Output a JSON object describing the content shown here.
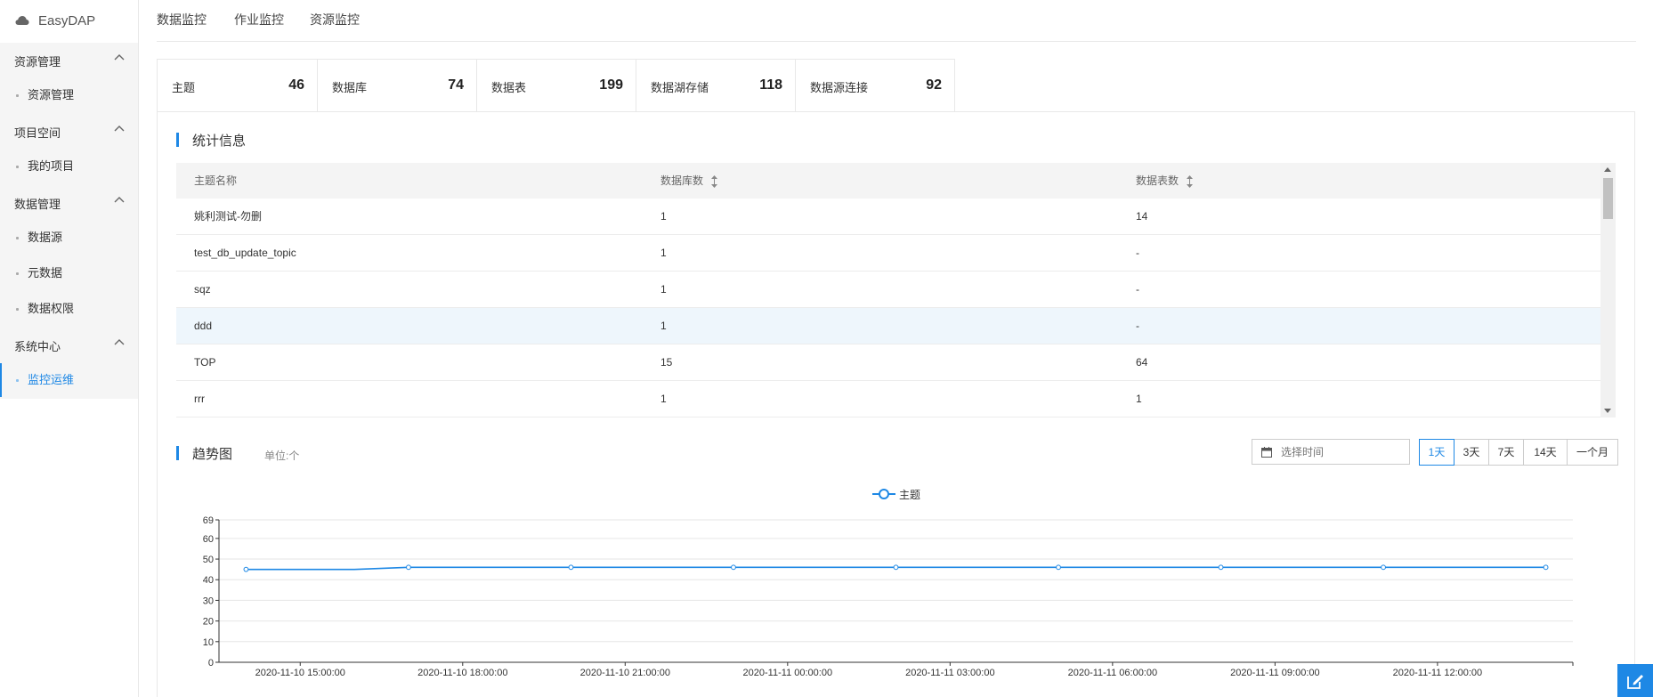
{
  "app": {
    "logo_text": "EasyDAP"
  },
  "sidebar": {
    "groups": [
      {
        "title": "资源管理",
        "items": [
          {
            "label": "资源管理",
            "active": false
          }
        ]
      },
      {
        "title": "项目空间",
        "items": [
          {
            "label": "我的项目",
            "active": false
          }
        ]
      },
      {
        "title": "数据管理",
        "items": [
          {
            "label": "数据源",
            "active": false
          },
          {
            "label": "元数据",
            "active": false
          },
          {
            "label": "数据权限",
            "active": false
          }
        ]
      },
      {
        "title": "系统中心",
        "items": [
          {
            "label": "监控运维",
            "active": true
          }
        ]
      }
    ]
  },
  "top_tabs": [
    {
      "label": "数据监控",
      "active": true
    },
    {
      "label": "作业监控",
      "active": false
    },
    {
      "label": "资源监控",
      "active": false
    }
  ],
  "stat_tabs": [
    {
      "label": "主题",
      "value": "46",
      "active": true
    },
    {
      "label": "数据库",
      "value": "74",
      "active": false
    },
    {
      "label": "数据表",
      "value": "199",
      "active": false
    },
    {
      "label": "数据湖存储",
      "value": "118",
      "active": false
    },
    {
      "label": "数据源连接",
      "value": "92",
      "active": false
    }
  ],
  "stats_section": {
    "title": "统计信息",
    "columns": [
      "主题名称",
      "数据库数",
      "数据表数"
    ],
    "rows": [
      [
        "姚利测试-勿删",
        "1",
        "14"
      ],
      [
        "test_db_update_topic",
        "1",
        "-"
      ],
      [
        "sqz",
        "1",
        "-"
      ],
      [
        "ddd",
        "1",
        "-"
      ],
      [
        "TOP",
        "15",
        "64"
      ],
      [
        "rrr",
        "1",
        "1"
      ]
    ],
    "highlighted_row": 3
  },
  "trend_section": {
    "title": "趋势图",
    "unit": "单位:个",
    "date_placeholder": "选择时间",
    "ranges": [
      {
        "label": "1天",
        "active": true
      },
      {
        "label": "3天",
        "active": false
      },
      {
        "label": "7天",
        "active": false
      },
      {
        "label": "14天",
        "active": false
      },
      {
        "label": "一个月",
        "active": false
      }
    ]
  },
  "colors": {
    "accent": "#1e88e5",
    "line": "#1e88e5"
  },
  "icons": {
    "logo": "cloud-icon",
    "collapse": "chevron-up-icon",
    "date": "calendar-icon",
    "sort": "sort-icon",
    "fab": "edit-icon"
  },
  "chart_data": {
    "type": "line",
    "series": [
      {
        "name": "主题",
        "x": [
          "2020-11-10 14:00:00",
          "2020-11-10 15:00:00",
          "2020-11-10 16:00:00",
          "2020-11-10 17:00:00",
          "2020-11-10 18:00:00",
          "2020-11-10 19:00:00",
          "2020-11-10 20:00:00",
          "2020-11-10 21:00:00",
          "2020-11-10 22:00:00",
          "2020-11-10 23:00:00",
          "2020-11-11 00:00:00",
          "2020-11-11 01:00:00",
          "2020-11-11 02:00:00",
          "2020-11-11 03:00:00",
          "2020-11-11 04:00:00",
          "2020-11-11 05:00:00",
          "2020-11-11 06:00:00",
          "2020-11-11 07:00:00",
          "2020-11-11 08:00:00",
          "2020-11-11 09:00:00",
          "2020-11-11 10:00:00",
          "2020-11-11 11:00:00",
          "2020-11-11 12:00:00",
          "2020-11-11 13:00:00",
          "2020-11-11 14:00:00"
        ],
        "values": [
          45,
          45,
          45,
          46,
          46,
          46,
          46,
          46,
          46,
          46,
          46,
          46,
          46,
          46,
          46,
          46,
          46,
          46,
          46,
          46,
          46,
          46,
          46,
          46,
          46
        ],
        "marker_every": 3
      }
    ],
    "x_tick_labels": [
      "2020-11-10 15:00:00",
      "2020-11-10 18:00:00",
      "2020-11-10 21:00:00",
      "2020-11-11 00:00:00",
      "2020-11-11 03:00:00",
      "2020-11-11 06:00:00",
      "2020-11-11 09:00:00",
      "2020-11-11 12:00:00"
    ],
    "y_ticks": [
      0,
      10,
      20,
      30,
      40,
      50,
      60,
      69
    ],
    "ylim": [
      0,
      69
    ],
    "grid": true,
    "legend_position": "top-center"
  }
}
